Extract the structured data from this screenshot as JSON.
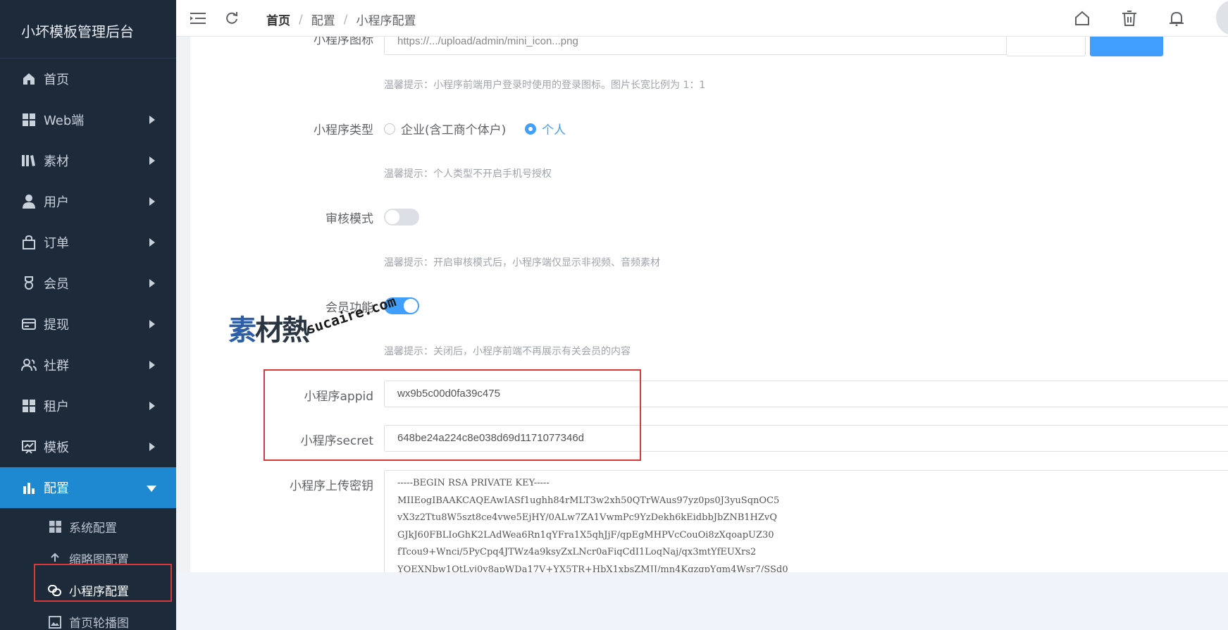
{
  "sidebar": {
    "title": "小坏模板管理后台",
    "items": [
      {
        "label": "首页",
        "icon": "home-icon",
        "has_arrow": false
      },
      {
        "label": "Web端",
        "icon": "grid-icon",
        "has_arrow": true
      },
      {
        "label": "素材",
        "icon": "library-icon",
        "has_arrow": true
      },
      {
        "label": "用户",
        "icon": "user-icon",
        "has_arrow": true
      },
      {
        "label": "订单",
        "icon": "bag-icon",
        "has_arrow": true
      },
      {
        "label": "会员",
        "icon": "medal-icon",
        "has_arrow": true
      },
      {
        "label": "提现",
        "icon": "card-icon",
        "has_arrow": true
      },
      {
        "label": "社群",
        "icon": "group-icon",
        "has_arrow": true
      },
      {
        "label": "租户",
        "icon": "grid-icon",
        "has_arrow": true
      },
      {
        "label": "模板",
        "icon": "chart-line-icon",
        "has_arrow": true
      },
      {
        "label": "配置",
        "icon": "bar-chart-icon",
        "has_arrow": true,
        "active": true
      }
    ],
    "submenu": [
      {
        "label": "系统配置",
        "icon": "grid-icon"
      },
      {
        "label": "缩略图配置",
        "icon": "upload-icon"
      },
      {
        "label": "小程序配置",
        "icon": "link-icon",
        "current": true
      },
      {
        "label": "首页轮播图",
        "icon": "image-icon"
      }
    ]
  },
  "header": {
    "breadcrumb": [
      "首页",
      "配置",
      "小程序配置"
    ],
    "breadcrumb_separator": "/",
    "icons": [
      "menu-fold-icon",
      "refresh-icon",
      "home-outline-icon",
      "trash-icon",
      "bell-icon"
    ]
  },
  "form": {
    "icon_label_partial": "小程序图标",
    "icon_url_partial": "https://.../upload/admin/mini_icon...png",
    "icon_hint": "温馨提示：小程序前端用户登录时使用的登录图标。图片长宽比例为 1：1",
    "type_label": "小程序类型",
    "type_options": [
      "企业(含工商个体户)",
      "个人"
    ],
    "type_selected": "个人",
    "type_hint": "温馨提示：个人类型不开启手机号授权",
    "audit_label": "审核模式",
    "audit_on": false,
    "audit_hint": "温馨提示：开启审核模式后，小程序端仅显示非视频、音频素材",
    "member_label": "会员功能",
    "member_on": true,
    "member_hint": "温馨提示：关闭后，小程序前端不再展示有关会员的内容",
    "appid_label": "小程序appid",
    "appid_value": "wx9b5c00d0fa39c475",
    "secret_label": "小程序secret",
    "secret_value": "648be24a224c8e038d69d1171077346d",
    "upload_key_label": "小程序上传密钥",
    "upload_key_value": "-----BEGIN RSA PRIVATE KEY-----\nMIIEogIBAAKCAQEAwIASf1ughh84rMLT3w2xh50QTrWAus97yz0ps0J3yuSqnOC5\nvX3z2Ttu8W5szt8ce4vwe5EjHY/0ALw7ZA1VwmPc9YzDekh6kEidbbJbZNB1HZvQ\nGJkJ60FBLIoGhK2LAdWea6Rn1qYFra1X5qhJjF/qpEgMHPVcCouOi8zXqoapUZ30\nfTcou9+Wnci/5PyCpq4JTWz4a9ksyZxLNcr0aFiqCdI1LoqNaj/qx3mtYfEUXrs2\nYOEXNbw1QtLvj0y8apWDa17V+YX5TR+HbX1xbsZMJJ/mn4KgzqpYgm4Wsr7/SSd0"
  },
  "watermark": {
    "cn": "素材熱",
    "en": "sucaire.com"
  },
  "colors": {
    "sidebar_bg": "#1d2a3a",
    "active_bg": "#1e88d0",
    "primary": "#409eff",
    "highlight_box": "#d9383a"
  }
}
